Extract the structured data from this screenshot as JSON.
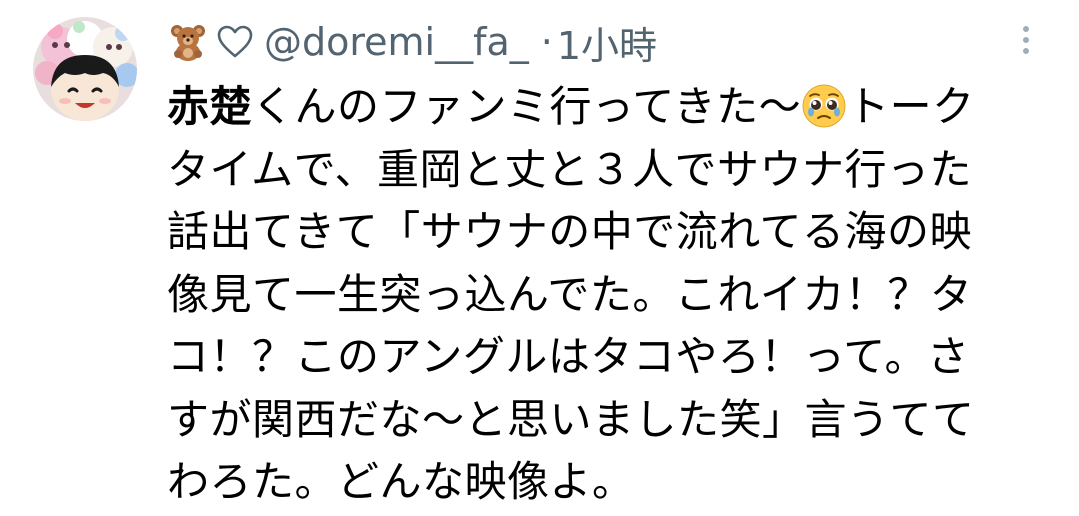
{
  "tweet": {
    "display_name_emojis": [
      "teddy-bear",
      "white-heart"
    ],
    "handle": "@doremi__fa_",
    "separator": "·",
    "time": "1小時",
    "body": {
      "bold_prefix": "赤楚",
      "line1_rest": "くんのファンミ行ってきた〜",
      "emoji": "pleading-face",
      "after_emoji": "トーク",
      "rest": "タイムで、重岡と丈と３人でサウナ行った\n話出てきて「サウナの中で流れてる海の映\n像見て一生突っ込んでた。これイカ！？タ\nコ！？このアングルはタコやろ！って。さ\nすが関西だな〜と思いました笑」言うてて\nわろた。どんな映像よ。"
    }
  },
  "colors": {
    "secondary_text": "#536471",
    "primary_text": "#000000",
    "background": "#ffffff"
  }
}
